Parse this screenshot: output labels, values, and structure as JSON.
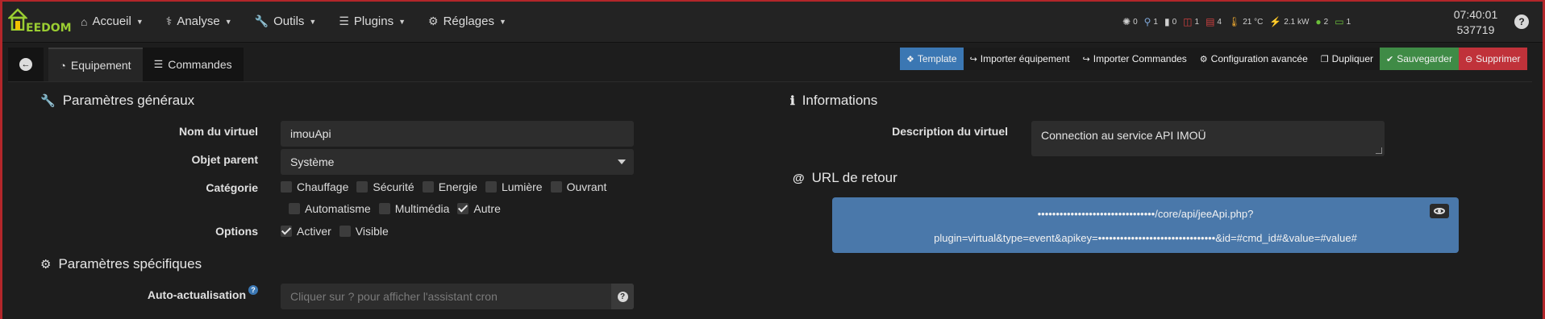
{
  "logo": {
    "brand": "EEDOM"
  },
  "nav": {
    "items": [
      {
        "icon": "⌂",
        "label": "Accueil"
      },
      {
        "icon": "⚕",
        "label": "Analyse"
      },
      {
        "icon": "🔧",
        "label": "Outils"
      },
      {
        "icon": "☰",
        "label": "Plugins"
      },
      {
        "icon": "⚙",
        "label": "Réglages"
      }
    ],
    "help": "?"
  },
  "status": {
    "alarm": "0",
    "motion": "1",
    "door": "0",
    "window": "1",
    "shutter": "4",
    "temperature": "21 °C",
    "power": "2.1 kW",
    "presence": "2",
    "battery": "1"
  },
  "clock": {
    "time": "07:40:01",
    "counter": "537719"
  },
  "tabs": {
    "back": "←",
    "equipement": "Equipement",
    "commandes": "Commandes"
  },
  "toolbar": {
    "template": "Template",
    "import_equipement": "Importer équipement",
    "import_commandes": "Importer Commandes",
    "config_avancee": "Configuration avancée",
    "dupliquer": "Dupliquer",
    "sauvegarder": "Sauvegarder",
    "supprimer": "Supprimer"
  },
  "general": {
    "title": "Paramètres généraux",
    "name_label": "Nom du virtuel",
    "name_value": "imouApi",
    "parent_label": "Objet parent",
    "parent_value": "Système",
    "category_label": "Catégorie",
    "categories": [
      {
        "label": "Chauffage",
        "checked": false
      },
      {
        "label": "Sécurité",
        "checked": false
      },
      {
        "label": "Energie",
        "checked": false
      },
      {
        "label": "Lumière",
        "checked": false
      },
      {
        "label": "Ouvrant",
        "checked": false
      },
      {
        "label": "Automatisme",
        "checked": false
      },
      {
        "label": "Multimédia",
        "checked": false
      },
      {
        "label": "Autre",
        "checked": true
      }
    ],
    "options_label": "Options",
    "options": [
      {
        "label": "Activer",
        "checked": true
      },
      {
        "label": "Visible",
        "checked": false
      }
    ]
  },
  "specific": {
    "title": "Paramètres spécifiques",
    "auto_label": "Auto-actualisation",
    "auto_placeholder": "Cliquer sur ? pour afficher l'assistant cron",
    "help": "?"
  },
  "informations": {
    "title": "Informations",
    "desc_label": "Description du virtuel",
    "desc_value": "Connection au service API IMOÜ"
  },
  "url": {
    "title": "URL de retour",
    "line1": "••••••••••••••••••••••••••••••••/core/api/jeeApi.php?",
    "line2": "plugin=virtual&type=event&apikey=••••••••••••••••••••••••••••••••&id=#cmd_id#&value=#value#"
  }
}
